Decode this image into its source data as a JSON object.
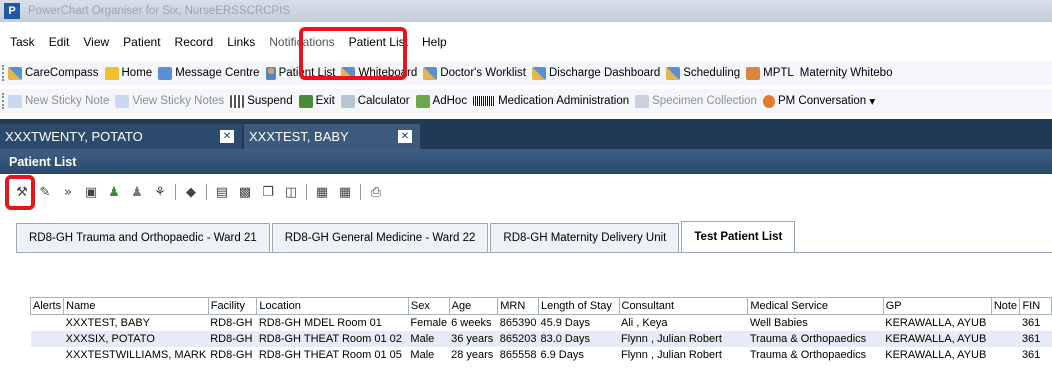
{
  "window": {
    "title": "PowerChart Organiser for Six, NurseERSSCRCPIS",
    "app_icon": "P"
  },
  "menu": [
    "Task",
    "Edit",
    "View",
    "Patient",
    "Record",
    "Links",
    "Notifications",
    "Patient List",
    "Help"
  ],
  "toolbar1": [
    {
      "label": "CareCompass",
      "icon": "grid-icon"
    },
    {
      "label": "Home",
      "icon": "home-icon"
    },
    {
      "label": "Message Centre",
      "icon": "message-icon"
    },
    {
      "label": "Patient List",
      "icon": "person-icon"
    },
    {
      "label": "Whiteboard",
      "icon": "grid-icon"
    },
    {
      "label": "Doctor's Worklist",
      "icon": "grid-icon"
    },
    {
      "label": "Discharge Dashboard",
      "icon": "grid-icon"
    },
    {
      "label": "Scheduling",
      "icon": "grid-icon"
    },
    {
      "label": "MPTL",
      "icon": "people-icon"
    },
    {
      "label": "Maternity Whitebo",
      "icon": ""
    }
  ],
  "toolbar2": [
    {
      "label": "New Sticky Note",
      "icon": "sticky-note-icon",
      "disabled": true
    },
    {
      "label": "View Sticky Notes",
      "icon": "sticky-note-icon",
      "disabled": true
    },
    {
      "label": "Suspend",
      "icon": "suspend-icon",
      "disabled": false
    },
    {
      "label": "Exit",
      "icon": "exit-icon",
      "disabled": false
    },
    {
      "label": "Calculator",
      "icon": "calculator-icon",
      "disabled": false
    },
    {
      "label": "AdHoc",
      "icon": "adhoc-icon",
      "disabled": false
    },
    {
      "label": "Medication Administration",
      "icon": "barcode-icon",
      "disabled": false
    },
    {
      "label": "Specimen Collection",
      "icon": "specimen-icon",
      "disabled": true
    },
    {
      "label": "PM Conversation",
      "icon": "pm-icon",
      "disabled": false
    }
  ],
  "patient_tabs": [
    "XXXTWENTY, POTATO",
    "XXXTEST, BABY"
  ],
  "section": {
    "title": "Patient List"
  },
  "list_toolbar_icons": [
    "properties-icon",
    "edit-icon",
    "forward-icon",
    "view-icon",
    "add-person-icon",
    "remove-person-icon",
    "print-icon",
    "shield-icon",
    "notes-icon",
    "clipboard-icon",
    "copy-icon",
    "paste-icon",
    "card-icon",
    "form-icon",
    "printer-icon"
  ],
  "list_tabs": [
    {
      "label": "RD8-GH Trauma and Orthopaedic - Ward 21",
      "active": false
    },
    {
      "label": "RD8-GH General Medicine - Ward 22",
      "active": false
    },
    {
      "label": "RD8-GH Maternity Delivery Unit",
      "active": false
    },
    {
      "label": "Test Patient List",
      "active": true
    }
  ],
  "columns": [
    "Alerts",
    "Name",
    "Facility",
    "Location",
    "Sex",
    "Age",
    "MRN",
    "Length of Stay",
    "Consultant",
    "Medical Service",
    "GP",
    "Note",
    "FIN"
  ],
  "rows": [
    [
      "",
      "XXXTEST, BABY",
      "RD8-GH",
      "RD8-GH MDEL Room 01",
      "Female",
      "6 weeks",
      "865390",
      "45.9 Days",
      "Ali , Keya",
      "Well Babies",
      "KERAWALLA, AYUB",
      "",
      "361"
    ],
    [
      "",
      "XXXSIX, POTATO",
      "RD8-GH",
      "RD8-GH THEAT Room 01 02",
      "Male",
      "36 years",
      "865203",
      "83.0 Days",
      "Flynn , Julian Robert",
      "Trauma & Orthopaedics",
      "KERAWALLA, AYUB",
      "",
      "361"
    ],
    [
      "",
      "XXXTESTWILLIAMS, MARK",
      "RD8-GH",
      "RD8-GH THEAT Room 01 05",
      "Male",
      "28 years",
      "865558",
      "6.9 Days",
      "Flynn , Julian Robert",
      "Trauma & Orthopaedics",
      "KERAWALLA, AYUB",
      "",
      "361"
    ]
  ],
  "colors": {
    "highlight": "#e8141c",
    "header_dark": "#203a56",
    "row_alt": "#e6ebf5"
  }
}
